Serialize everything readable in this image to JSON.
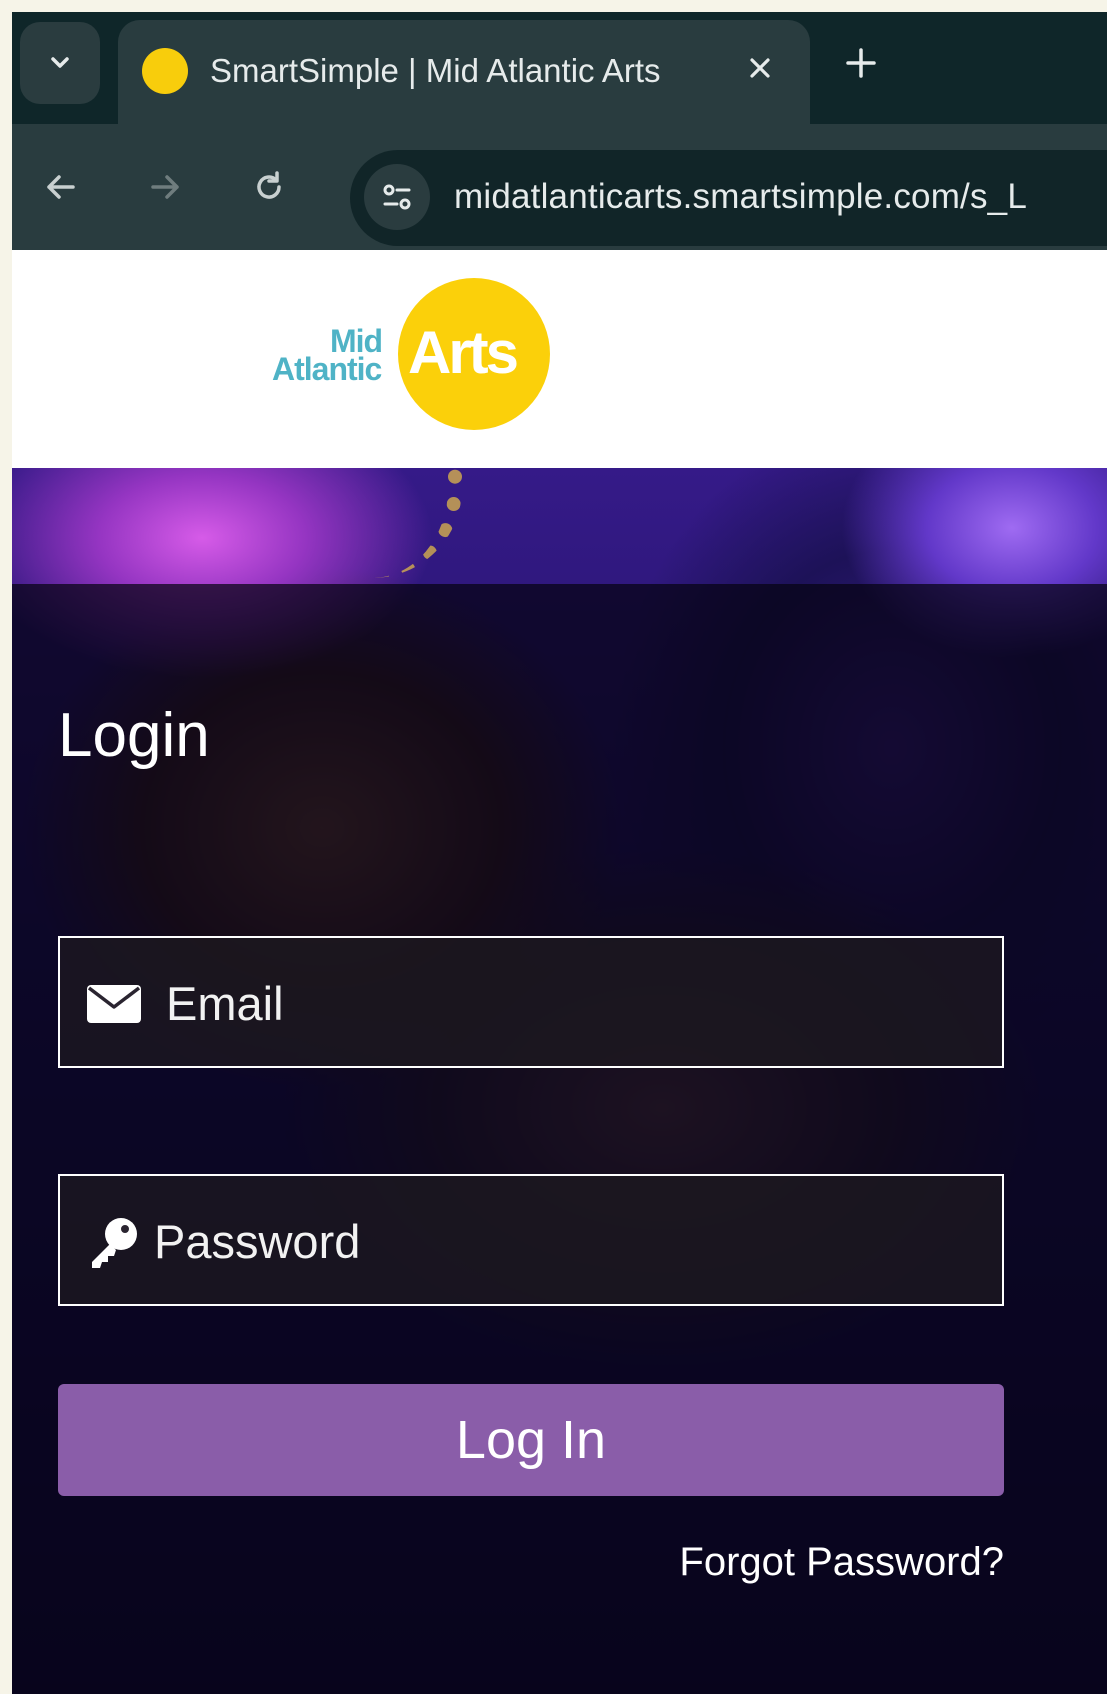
{
  "browser": {
    "tab": {
      "title": "SmartSimple | Mid Atlantic Arts",
      "favicon_color": "#f8cd0c"
    },
    "url": "midatlanticarts.smartsimple.com/s_L",
    "icons": {
      "tab_menu": "chevron-down-icon",
      "close": "close-icon",
      "new_tab": "plus-icon",
      "back": "arrow-left-icon",
      "forward": "arrow-right-icon",
      "reload": "reload-icon",
      "site_info": "tune-icon"
    }
  },
  "header": {
    "logo": {
      "line1": "Mid",
      "line2": "Atlantic",
      "word": "Arts",
      "text_color": "#4fb3c6",
      "circle_color": "#fbd00a"
    }
  },
  "login": {
    "title": "Login",
    "email": {
      "placeholder": "Email",
      "value": "",
      "icon": "envelope-icon"
    },
    "password": {
      "placeholder": "Password",
      "value": "",
      "icon": "key-icon"
    },
    "submit_label": "Log In",
    "forgot_label": "Forgot Password?",
    "button_color": "#8a5da9"
  }
}
